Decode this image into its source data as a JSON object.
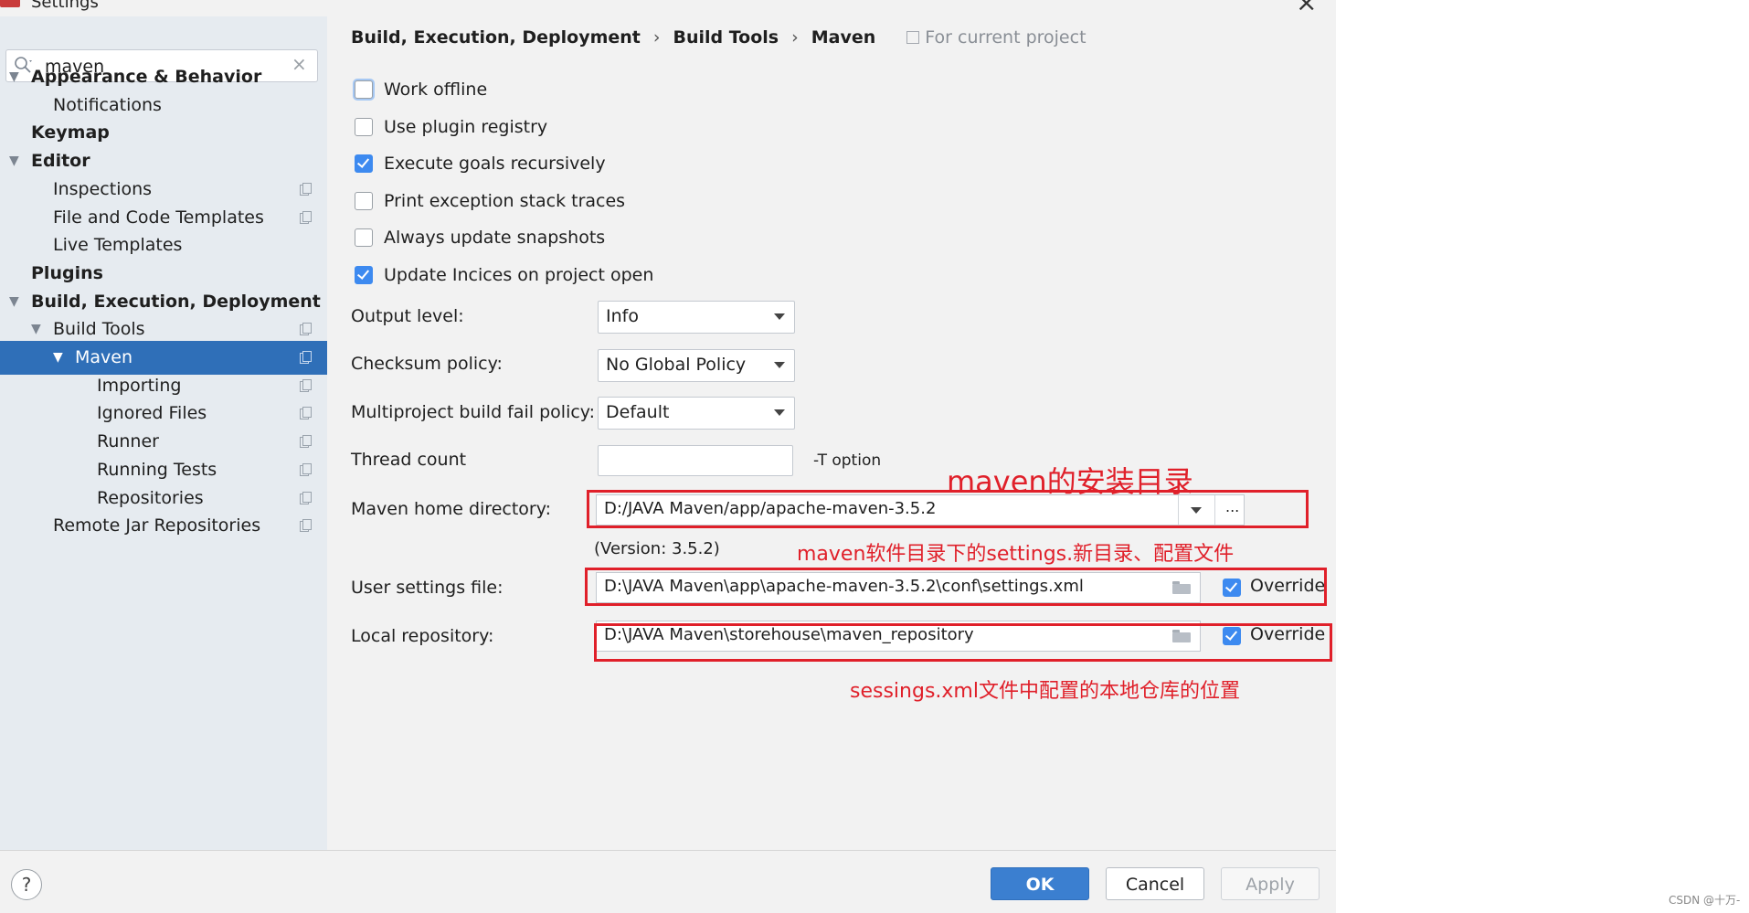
{
  "window": {
    "title": "Settings"
  },
  "search": {
    "value": "maven",
    "placeholder": ""
  },
  "sidebar": {
    "items": [
      {
        "label": "Appearance & Behavior"
      },
      {
        "label": "Notifications"
      },
      {
        "label": "Keymap"
      },
      {
        "label": "Editor"
      },
      {
        "label": "Inspections"
      },
      {
        "label": "File and Code Templates"
      },
      {
        "label": "Live Templates"
      },
      {
        "label": "Plugins"
      },
      {
        "label": "Build, Execution, Deployment"
      },
      {
        "label": "Build Tools"
      },
      {
        "label": "Maven"
      },
      {
        "label": "Importing"
      },
      {
        "label": "Ignored Files"
      },
      {
        "label": "Runner"
      },
      {
        "label": "Running Tests"
      },
      {
        "label": "Repositories"
      },
      {
        "label": "Remote Jar Repositories"
      }
    ],
    "selected": "Maven"
  },
  "breadcrumb": {
    "parts": [
      "Build, Execution, Deployment",
      "Build Tools",
      "Maven"
    ],
    "separator": "›",
    "scope": "For current project"
  },
  "checkboxes": [
    {
      "label": "Work offline",
      "checked": false
    },
    {
      "label": "Use plugin registry",
      "checked": false
    },
    {
      "label": "Execute goals recursively",
      "checked": true
    },
    {
      "label": "Print exception stack traces",
      "checked": false
    },
    {
      "label": "Always update snapshots",
      "checked": false
    },
    {
      "label": "Update Incices on project open",
      "checked": true
    }
  ],
  "fields": {
    "output_level": {
      "label": "Output level:",
      "value": "Info"
    },
    "checksum_policy": {
      "label": "Checksum policy:",
      "value": "No Global Policy"
    },
    "fail_policy": {
      "label": "Multiproject build fail policy:",
      "value": "Default"
    },
    "thread_count": {
      "label": "Thread count",
      "value": "",
      "hint": "-T option"
    },
    "maven_home": {
      "label": "Maven home directory:",
      "value": "D:/JAVA Maven/app/apache-maven-3.5.2",
      "browse": "...",
      "version": "(Version: 3.5.2)"
    },
    "user_settings": {
      "label": "User settings file:",
      "value": "D:\\JAVA Maven\\app\\apache-maven-3.5.2\\conf\\settings.xml",
      "override": "Override",
      "override_checked": true
    },
    "local_repo": {
      "label": "Local repository:",
      "value": "D:\\JAVA Maven\\storehouse\\maven_repository",
      "override": "Override",
      "override_checked": true
    }
  },
  "annotations": {
    "home": "maven的安装目录",
    "settings": "maven软件目录下的settings.新目录、配置文件",
    "repo": "sessings.xml文件中配置的本地仓库的位置"
  },
  "buttons": {
    "help": "?",
    "ok": "OK",
    "cancel": "Cancel",
    "apply": "Apply"
  },
  "watermark": "CSDN @十万-",
  "colors": {
    "accent": "#3b7fd0",
    "selection": "#2f6fb8",
    "annotation": "#e0202a"
  }
}
